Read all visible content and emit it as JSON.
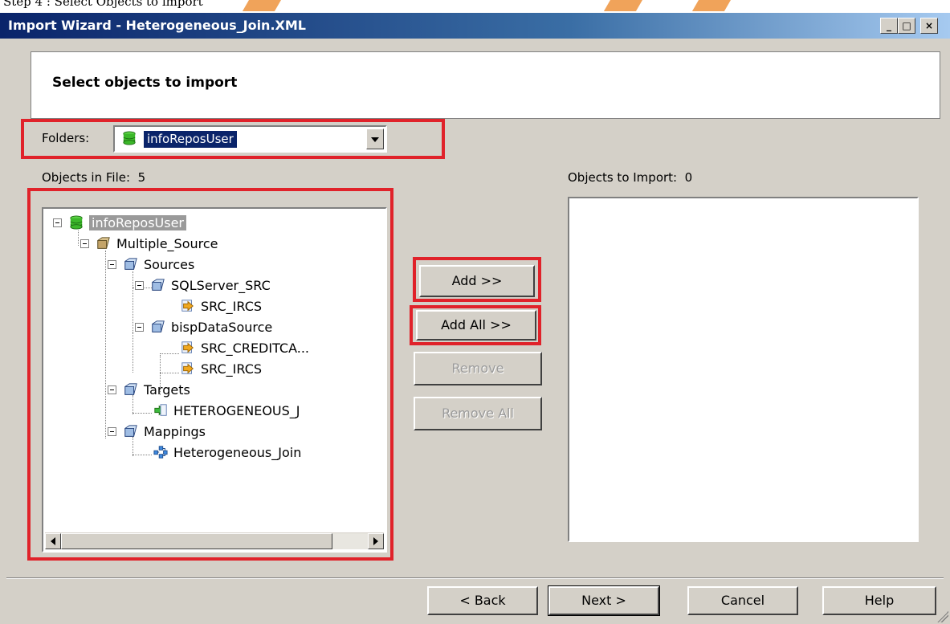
{
  "doc_strip": {
    "text": "Step 4 : Select Objects to import"
  },
  "window": {
    "title": "Import Wizard - Heterogeneous_Join.XML",
    "controls": {
      "minimize": "_",
      "maximize": "□",
      "close": "×"
    }
  },
  "header": {
    "title": "Select objects to import"
  },
  "folders": {
    "label": "Folders:",
    "selected": "infoReposUser"
  },
  "objects_in_file": {
    "label": "Objects in File:",
    "count": "5"
  },
  "objects_to_import": {
    "label": "Objects to Import:",
    "count": "0"
  },
  "tree": {
    "root": {
      "label": "infoReposUser",
      "icon": "database-icon"
    },
    "folder": {
      "label": "Multiple_Source",
      "icon": "folder-icon"
    },
    "sources": {
      "label": "Sources",
      "icon": "folder-icon"
    },
    "sqlserver": {
      "label": "SQLServer_SRC",
      "icon": "folder-icon"
    },
    "sqlserver_src_ircs": {
      "label": "SRC_IRCS",
      "icon": "source-icon"
    },
    "bisp": {
      "label": "bispDataSource",
      "icon": "folder-icon"
    },
    "bisp_src_credit": {
      "label": "SRC_CREDITCA...",
      "icon": "source-icon"
    },
    "bisp_src_ircs": {
      "label": "SRC_IRCS",
      "icon": "source-icon"
    },
    "targets": {
      "label": "Targets",
      "icon": "folder-icon"
    },
    "target_item": {
      "label": "HETEROGENEOUS_J",
      "icon": "target-icon"
    },
    "mappings": {
      "label": "Mappings",
      "icon": "folder-icon"
    },
    "mapping_item": {
      "label": "Heterogeneous_Join",
      "icon": "mapping-icon"
    }
  },
  "buttons": {
    "add": "Add  >>",
    "add_all": "Add All >>",
    "remove": "Remove",
    "remove_all": "Remove All",
    "back": "< Back",
    "next": "Next >",
    "cancel": "Cancel",
    "help": "Help"
  },
  "colors": {
    "highlight_box": "#e0222a",
    "dialog_bg": "#d4d0c8",
    "title_bar": "#0a246a"
  }
}
